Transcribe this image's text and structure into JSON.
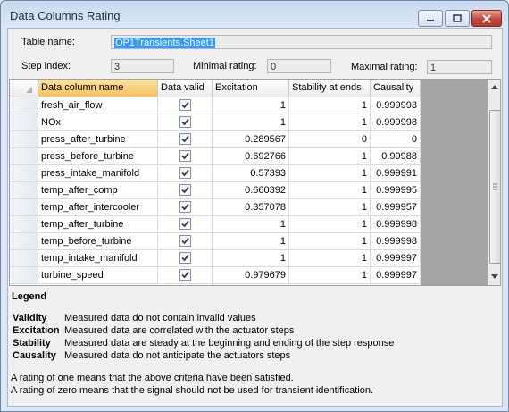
{
  "window": {
    "title": "Data Columns Rating",
    "icons": {
      "minimize": "minimize-icon",
      "maximize": "maximize-icon",
      "close": "close-icon"
    }
  },
  "form": {
    "table_name_label": "Table name:",
    "table_name_value": "OP1Transients.Sheet1",
    "step_index_label": "Step index:",
    "step_index_value": "3",
    "min_rating_label": "Minimal rating:",
    "min_rating_value": "0",
    "max_rating_label": "Maximal rating:",
    "max_rating_value": "1"
  },
  "grid": {
    "columns": [
      "Data column name",
      "Data valid",
      "Excitation",
      "Stability at ends",
      "Causality"
    ],
    "rows": [
      {
        "name": "fresh_air_flow",
        "valid": true,
        "excitation": "1",
        "stability": "1",
        "causality": "0.999993"
      },
      {
        "name": "NOx",
        "valid": true,
        "excitation": "1",
        "stability": "1",
        "causality": "0.999998"
      },
      {
        "name": "press_after_turbine",
        "valid": true,
        "excitation": "0.289567",
        "stability": "0",
        "causality": "0"
      },
      {
        "name": "press_before_turbine",
        "valid": true,
        "excitation": "0.692766",
        "stability": "1",
        "causality": "0.99988"
      },
      {
        "name": "press_intake_manifold",
        "valid": true,
        "excitation": "0.57393",
        "stability": "1",
        "causality": "0.999991"
      },
      {
        "name": "temp_after_comp",
        "valid": true,
        "excitation": "0.660392",
        "stability": "1",
        "causality": "0.999995"
      },
      {
        "name": "temp_after_intercooler",
        "valid": true,
        "excitation": "0.357078",
        "stability": "1",
        "causality": "0.999957"
      },
      {
        "name": "temp_after_turbine",
        "valid": true,
        "excitation": "1",
        "stability": "1",
        "causality": "0.999998"
      },
      {
        "name": "temp_before_turbine",
        "valid": true,
        "excitation": "1",
        "stability": "1",
        "causality": "0.999998"
      },
      {
        "name": "temp_intake_manifold",
        "valid": true,
        "excitation": "1",
        "stability": "1",
        "causality": "0.999997"
      },
      {
        "name": "turbine_speed",
        "valid": true,
        "excitation": "0.979679",
        "stability": "1",
        "causality": "0.999997"
      }
    ]
  },
  "legend": {
    "title": "Legend",
    "items": [
      {
        "term": "Validity",
        "desc": "Measured data do not contain invalid values"
      },
      {
        "term": "Excitation",
        "desc": "Measured data are correlated with the actuator steps"
      },
      {
        "term": "Stability",
        "desc": "Measured data are steady at the beginning and ending of the step response"
      },
      {
        "term": "Causality",
        "desc": "Measured data do not anticipate the actuators steps"
      }
    ],
    "note1": "A rating of one means that the above criteria have been satisfied.",
    "note2": "A rating of zero means that the signal should not be used for transient identification."
  },
  "colors": {
    "active_header": "#f6c05c",
    "selection": "#3399ff",
    "close_button": "#c6463a"
  }
}
